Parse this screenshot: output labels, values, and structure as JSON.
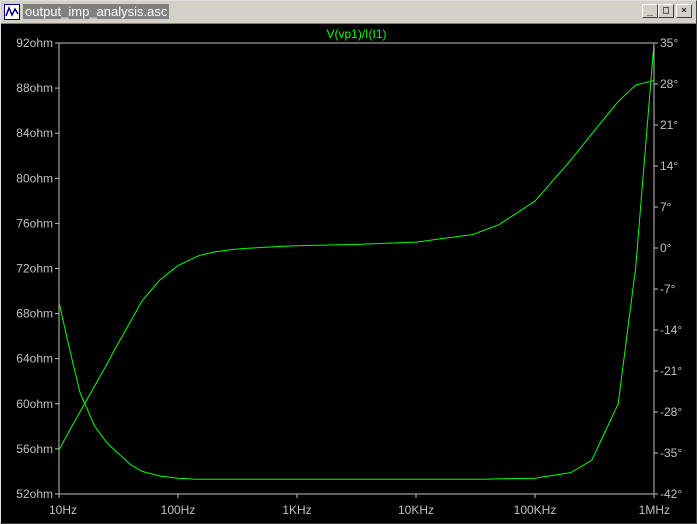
{
  "window": {
    "title": "output_imp_analysis.asc",
    "min_glyph": "_",
    "max_glyph": "□",
    "close_glyph": "×"
  },
  "colors": {
    "background": "#000000",
    "trace": "#00ff00",
    "axis": "#c0c0c0",
    "frame": "#d4d0c8"
  },
  "chart_data": {
    "type": "line",
    "title": "V(vp1)/I(I1)",
    "x_scale": "log",
    "x_ticks": [
      "10Hz",
      "100Hz",
      "1KHz",
      "10KHz",
      "100KHz",
      "1MHz"
    ],
    "x_tick_values": [
      10,
      100,
      1000,
      10000,
      100000,
      1000000
    ],
    "xlim": [
      10,
      1000000
    ],
    "y_left_ticks": [
      "92ohm",
      "88ohm",
      "84ohm",
      "80ohm",
      "76ohm",
      "72ohm",
      "68ohm",
      "64ohm",
      "60ohm",
      "56ohm",
      "52ohm"
    ],
    "y_left_values": [
      92,
      88,
      84,
      80,
      76,
      72,
      68,
      64,
      60,
      56,
      52
    ],
    "ylim_left": [
      52,
      92
    ],
    "y_right_ticks": [
      "35°",
      "28°",
      "21°",
      "14°",
      "7°",
      "0°",
      "-7°",
      "-14°",
      "-21°",
      "-28°",
      "-35°",
      "-42°"
    ],
    "y_right_values": [
      35,
      28,
      21,
      14,
      7,
      0,
      -7,
      -14,
      -21,
      -28,
      -35,
      -42
    ],
    "ylim_right": [
      -42,
      35
    ],
    "grid": false,
    "series": [
      {
        "axis": "left",
        "x": [
          10,
          12,
          15,
          20,
          25,
          30,
          40,
          50,
          70,
          100,
          150,
          200,
          300,
          500,
          1000,
          3000,
          10000,
          30000,
          100000,
          200000,
          300000,
          500000,
          700000,
          1000000
        ],
        "y": [
          69.0,
          65.3,
          61.0,
          58.0,
          56.6,
          55.8,
          54.6,
          54.0,
          53.6,
          53.4,
          53.3,
          53.3,
          53.3,
          53.3,
          53.3,
          53.3,
          53.3,
          53.3,
          53.4,
          53.9,
          55.0,
          60.0,
          72.0,
          92.0
        ]
      },
      {
        "axis": "right",
        "x": [
          10,
          12,
          15,
          20,
          25,
          30,
          40,
          50,
          70,
          100,
          150,
          200,
          300,
          500,
          1000,
          3000,
          10000,
          30000,
          50000,
          100000,
          200000,
          300000,
          500000,
          700000,
          1000000
        ],
        "y": [
          -34.5,
          -31.5,
          -28.0,
          -23.5,
          -20.0,
          -17.0,
          -12.5,
          -9.0,
          -5.5,
          -3.0,
          -1.3,
          -0.7,
          -0.2,
          0.1,
          0.4,
          0.6,
          1.0,
          2.3,
          4.0,
          8.0,
          15.0,
          19.5,
          25.0,
          27.8,
          28.6
        ]
      }
    ]
  }
}
